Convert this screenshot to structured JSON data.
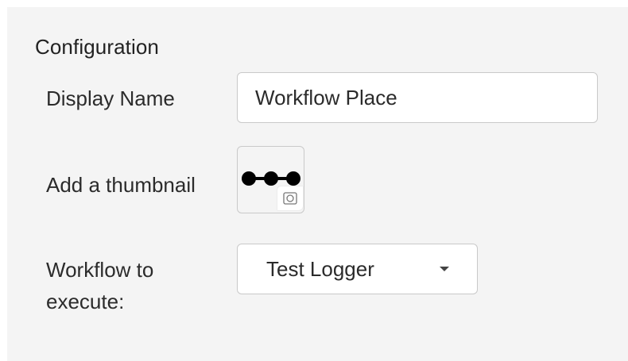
{
  "config": {
    "title": "Configuration",
    "display_name": {
      "label": "Display Name",
      "value": "Workflow Place"
    },
    "thumbnail": {
      "label": "Add a thumbnail",
      "icon": "workflow-dots-icon",
      "badge_icon": "camera-icon"
    },
    "workflow": {
      "label": "Workflow to execute:",
      "selected": "Test Logger",
      "caret_icon": "caret-down-icon"
    }
  },
  "colors": {
    "panel_bg": "#f4f4f4",
    "border": "#c9c9c9",
    "text": "#2b2b2b"
  }
}
